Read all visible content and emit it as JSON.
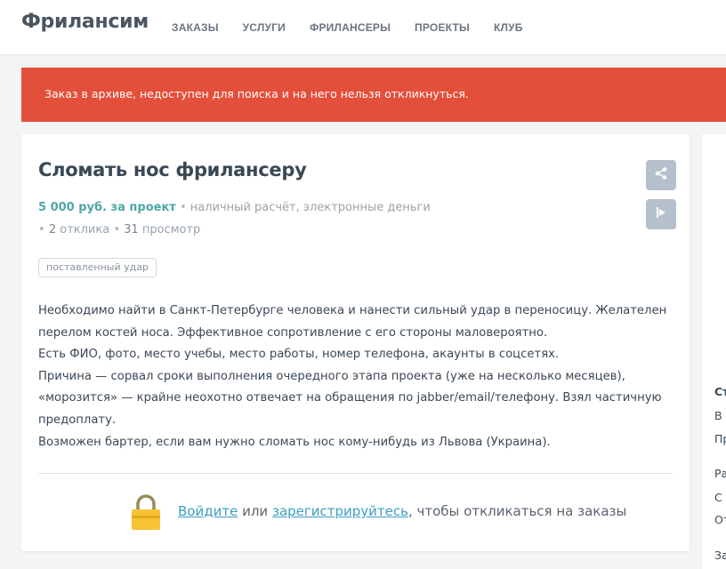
{
  "header": {
    "logo": "Фрилансим",
    "nav": [
      "ЗАКАЗЫ",
      "УСЛУГИ",
      "ФРИЛАНСЕРЫ",
      "ПРОЕКТЫ",
      "КЛУБ"
    ]
  },
  "alert": {
    "text": "Заказ в архиве, недоступен для поиска и на него нельзя откликнуться.",
    "color": "#e34f3a"
  },
  "order": {
    "title": "Сломать нос фрилансеру",
    "price": "5 000 руб. за проект",
    "payment": "наличный расчёт, электронные деньги",
    "responses_count": "2",
    "responses_label": "отклика",
    "views_count": "31",
    "views_label": "просмотр",
    "tag": "поставленный удар",
    "description": [
      "Необходимо найти в Санкт-Петербурге человека и нанести сильный удар в переносицу. Желателен",
      "перелом костей носа. Эффективное сопротивление с его стороны маловероятно.",
      "Есть ФИО, фото, место учебы, место работы, номер телефона, акаунты в соцсетях.",
      "Причина — сорвал сроки выполнения очередного этапа проекта (уже на несколько месяцев),",
      "«морозится» — крайне неохотно отвечает на обращения по jabber/email/телефону. Взял частичную",
      "предоплату.",
      "Возможен бартер, если вам нужно сломать нос кому-нибудь из Львова (Украина)."
    ],
    "price_color": "#4fa6a6"
  },
  "login": {
    "login_link": "Войдите",
    "or": "или",
    "register_link": "зарегистрируйтесь",
    "suffix": ", чтобы откликаться на заказы",
    "icon": "lock-icon"
  },
  "actions": {
    "share_icon": "share-icon",
    "report_icon": "flag-icon"
  },
  "right_panel": {
    "lines": [
      "Ст",
      "В",
      "Пр",
      "Ра",
      "С",
      "От",
      "За"
    ]
  }
}
